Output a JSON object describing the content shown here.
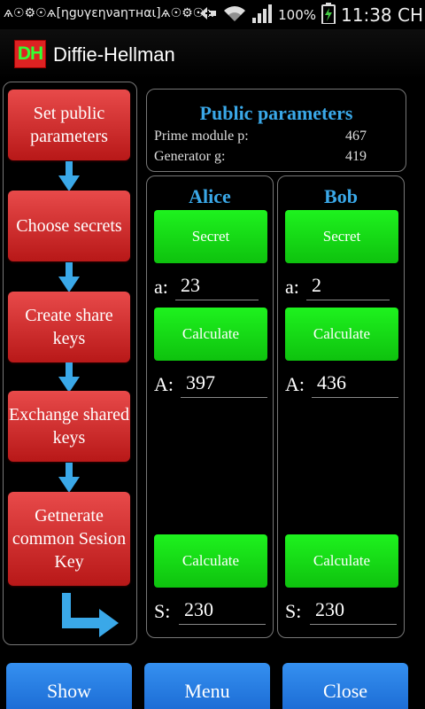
{
  "status_bar": {
    "left_text": "ѧ☉⚙☉ѧ[ηgυγεηνaηтнαι]ѧ☉⚙☉ѧ",
    "battery_percent": "100%",
    "time": "11:38 CH"
  },
  "app": {
    "logo_text": "DH",
    "title": "Diffie-Hellman"
  },
  "steps": [
    {
      "label": "Set public parameters"
    },
    {
      "label": "Choose secrets"
    },
    {
      "label": "Create share keys"
    },
    {
      "label": "Exchange shared keys"
    },
    {
      "label": "Getnerate common Sesion Key"
    }
  ],
  "public_params": {
    "title": "Public parameters",
    "prime_label": "Prime module p:",
    "prime_value": "467",
    "generator_label": "Generator g:",
    "generator_value": "419"
  },
  "alice": {
    "name": "Alice",
    "secret_button": "Secret",
    "secret_label": "a:",
    "secret_value": "23",
    "calc_button": "Calculate",
    "public_label": "A:",
    "public_value": "397",
    "calc2_button": "Calculate",
    "shared_label": "S:",
    "shared_value": "230"
  },
  "bob": {
    "name": "Bob",
    "secret_button": "Secret",
    "secret_label": "a:",
    "secret_value": "2",
    "calc_button": "Calculate",
    "public_label": "A:",
    "public_value": "436",
    "calc2_button": "Calculate",
    "shared_label": "S:",
    "shared_value": "230"
  },
  "bottom_bar": {
    "show": "Show",
    "menu": "Menu",
    "close": "Close"
  },
  "colors": {
    "step_red": "#d83030",
    "green_button": "#16d816",
    "accent_blue": "#3aa8e8",
    "bottom_blue": "#2a7fe6"
  }
}
